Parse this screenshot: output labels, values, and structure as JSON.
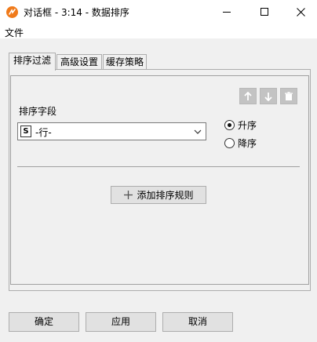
{
  "window": {
    "title": "对话框 - 3:14 - 数据排序",
    "app_icon": "app-logo-icon",
    "controls": [
      "minimize-icon",
      "maximize-icon",
      "close-icon"
    ]
  },
  "menu": {
    "file": "文件"
  },
  "tabs": [
    {
      "label": "排序过滤",
      "active": true
    },
    {
      "label": "高级设置",
      "active": false
    },
    {
      "label": "缓存策略",
      "active": false
    }
  ],
  "sort_panel": {
    "toolbar_icons": [
      "arrow-up-icon",
      "arrow-down-icon",
      "trash-icon"
    ],
    "field_label": "排序字段",
    "field_type_badge": "S",
    "field_value": "-行-",
    "order_options": {
      "asc": "升序",
      "desc": "降序",
      "selected": "asc"
    },
    "add_rule": "添加排序规则"
  },
  "footer": {
    "ok": "确定",
    "apply": "应用",
    "cancel": "取消"
  },
  "colors": {
    "app_icon": "#f07a1a",
    "disabled_button": "#c3c3c3",
    "window_bg": "#f0f0f0"
  }
}
